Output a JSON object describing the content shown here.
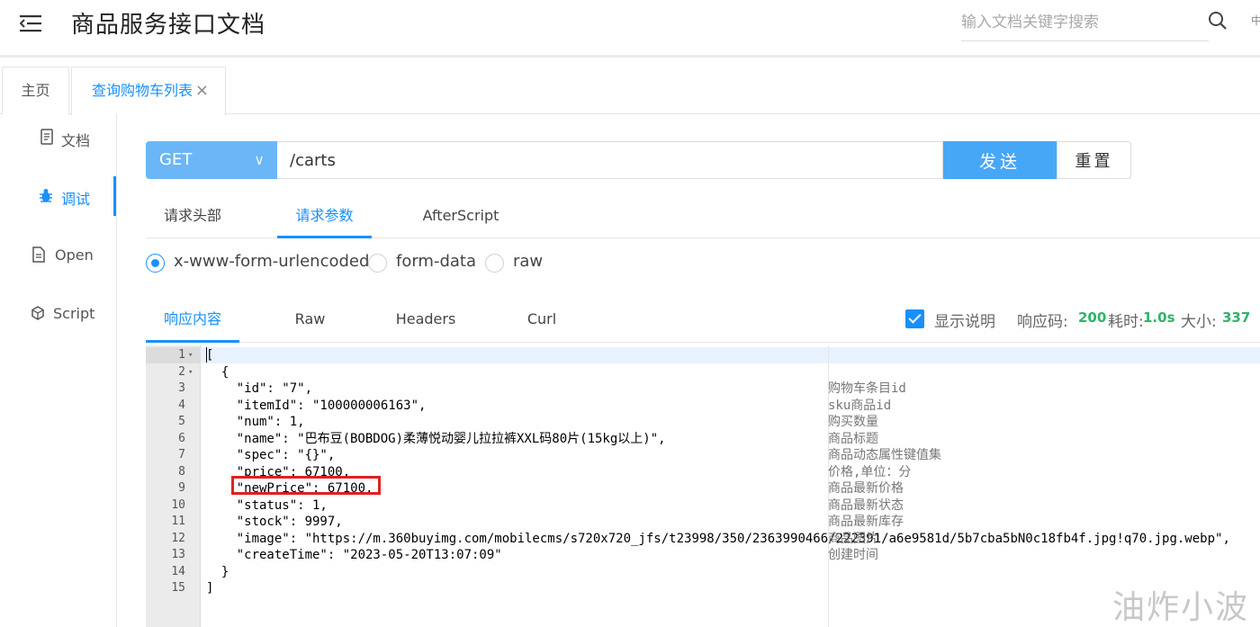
{
  "header": {
    "title": "商品服务接口文档",
    "search_placeholder": "输入文档关键字搜索",
    "more_label": "中"
  },
  "tabs": [
    {
      "label": "主页"
    },
    {
      "label": "查询购物车列表",
      "close": "×"
    }
  ],
  "sidebar": {
    "items": [
      {
        "label": "文档",
        "icon": "document-icon"
      },
      {
        "label": "调试",
        "icon": "bug-icon",
        "active": true
      },
      {
        "label": "Open",
        "icon": "file-icon"
      },
      {
        "label": "Script",
        "icon": "cube-icon"
      }
    ]
  },
  "request": {
    "method": "GET",
    "url": "/carts",
    "send_label": "发送",
    "reset_label": "重置"
  },
  "request_tabs": [
    {
      "label": "请求头部"
    },
    {
      "label": "请求参数",
      "active": true
    },
    {
      "label": "AfterScript"
    }
  ],
  "body_types": [
    {
      "label": "x-www-form-urlencoded",
      "checked": true
    },
    {
      "label": "form-data"
    },
    {
      "label": "raw"
    }
  ],
  "response_tabs": [
    {
      "label": "响应内容",
      "active": true
    },
    {
      "label": "Raw"
    },
    {
      "label": "Headers"
    },
    {
      "label": "Curl"
    }
  ],
  "response_meta": {
    "show_desc_label": "显示说明",
    "show_desc_checked": true,
    "status_label": "响应码:",
    "status_value": "200",
    "time_label": "耗时:",
    "time_value": "1.0s",
    "size_label": "大小:",
    "size_value": "337"
  },
  "code_lines": [
    {
      "n": "1",
      "fold": "▾",
      "text": "["
    },
    {
      "n": "2",
      "fold": "▾",
      "text": "  {"
    },
    {
      "n": "3",
      "text": "    \"id\": \"7\","
    },
    {
      "n": "4",
      "text": "    \"itemId\": \"100000006163\","
    },
    {
      "n": "5",
      "text": "    \"num\": 1,"
    },
    {
      "n": "6",
      "text": "    \"name\": \"巴布豆(BOBDOG)柔薄悦动婴儿拉拉裤XXL码80片(15kg以上)\","
    },
    {
      "n": "7",
      "text": "    \"spec\": \"{}\","
    },
    {
      "n": "8",
      "text": "    \"price\": 67100,"
    },
    {
      "n": "9",
      "text": "    \"newPrice\": 67100,"
    },
    {
      "n": "10",
      "text": "    \"status\": 1,"
    },
    {
      "n": "11",
      "text": "    \"stock\": 9997,"
    },
    {
      "n": "12",
      "text": "    \"image\": \"https://m.360buyimg.com/mobilecms/s720x720_jfs/t23998/350/2363990466/222391/a6e9581d/5b7cba5bN0c18fb4f.jpg!q70.jpg.webp\","
    },
    {
      "n": "13",
      "text": "    \"createTime\": \"2023-05-20T13:07:09\""
    },
    {
      "n": "14",
      "text": "  }"
    },
    {
      "n": "15",
      "text": "]"
    }
  ],
  "comments": [
    {
      "line": 3,
      "text": "购物车条目id"
    },
    {
      "line": 4,
      "text": "sku商品id"
    },
    {
      "line": 5,
      "text": "购买数量"
    },
    {
      "line": 6,
      "text": "商品标题"
    },
    {
      "line": 7,
      "text": "商品动态属性键值集"
    },
    {
      "line": 8,
      "text": "价格,单位：分"
    },
    {
      "line": 9,
      "text": "商品最新价格"
    },
    {
      "line": 10,
      "text": "商品最新状态"
    },
    {
      "line": 11,
      "text": "商品最新库存"
    },
    {
      "line": 12,
      "text": "商品图片"
    },
    {
      "line": 13,
      "text": "创建时间"
    }
  ],
  "watermark": "油炸小波",
  "colors": {
    "accent": "#1890ff",
    "method_bg": "#6ab6f7",
    "send_bg": "#47a7f7",
    "meta_value": "#2fb36b",
    "highlight": "#e02020"
  }
}
